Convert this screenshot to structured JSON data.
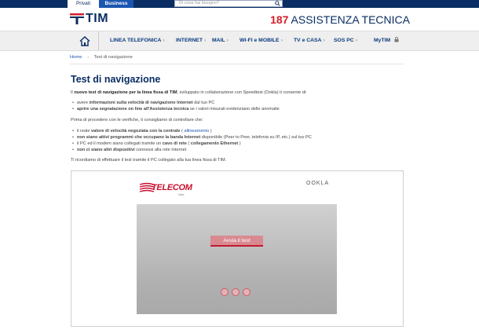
{
  "top": {
    "tabs": [
      {
        "label": "Privati"
      },
      {
        "label": "Business"
      }
    ],
    "search_placeholder": "Di cosa hai bisogno?"
  },
  "header": {
    "logo": "TIM",
    "assist_number": "187",
    "assist_label": "ASSISTENZA TECNICA"
  },
  "nav": {
    "items": [
      {
        "label": "LINEA TELEFONICA"
      },
      {
        "label": "INTERNET"
      },
      {
        "label": "MAIL"
      },
      {
        "label": "WI-FI e MOBILE"
      },
      {
        "label": "TV e CASA"
      },
      {
        "label": "SOS PC"
      },
      {
        "label": "MyTIM"
      }
    ]
  },
  "breadcrumb": {
    "home": "Home",
    "sep": "›",
    "current": "Test di navigazione"
  },
  "content": {
    "title": "Test di navigazione",
    "intro_pre": "Il ",
    "intro_bold": "nuovo test di navigazione per la linea fissa di TIM",
    "intro_post": ", sviluppato in collaborazione con Speedtest (Ookla) ti consente di:",
    "b1_pre": "avere ",
    "b1_bold": "informazioni sulla velocità di navigazione Internet",
    "b1_post": " dal tuo PC",
    "b2_bold": "aprire una segnalazione on line all'Assistenza tecnica",
    "b2_post": " se i valori misurati evidenziano delle anomalie",
    "before": "Prima di procedere con le verifiche, ti consigliamo di controllare che:",
    "c1_pre": "il reale ",
    "c1_bold": "valore di velocità negoziata con la centrale",
    "c1_mid": " ( ",
    "c1_link": "allineamento",
    "c1_post": " )",
    "c2_bold": "non siano attivi programmi che occupano la banda Internet",
    "c2_post": " disponibile (Peer to Peer, telefonia su IP, etc.) sul tuo PC",
    "c3_pre": "il PC ed il modem siano collegati tramite un ",
    "c3_bold": "cavo di rete",
    "c3_mid": " ( ",
    "c3_bold2": "collegamento Ethernet",
    "c3_post": " )",
    "c4_bold": "non ci siano altri dispositivi",
    "c4_post": " connessi alla rete Internet",
    "reminder": "Ti ricordiamo di effettuare il test tramite il PC collegato alla tua linea fissa di TIM."
  },
  "widget": {
    "brand": "TELECOM",
    "brand_sub": "Italia",
    "partner": "OOKLA",
    "start_label": "Avvia il test"
  },
  "colors": {
    "brand_blue": "#0a2d63",
    "brand_red": "#d21e2b",
    "accent": "#c3192d"
  }
}
